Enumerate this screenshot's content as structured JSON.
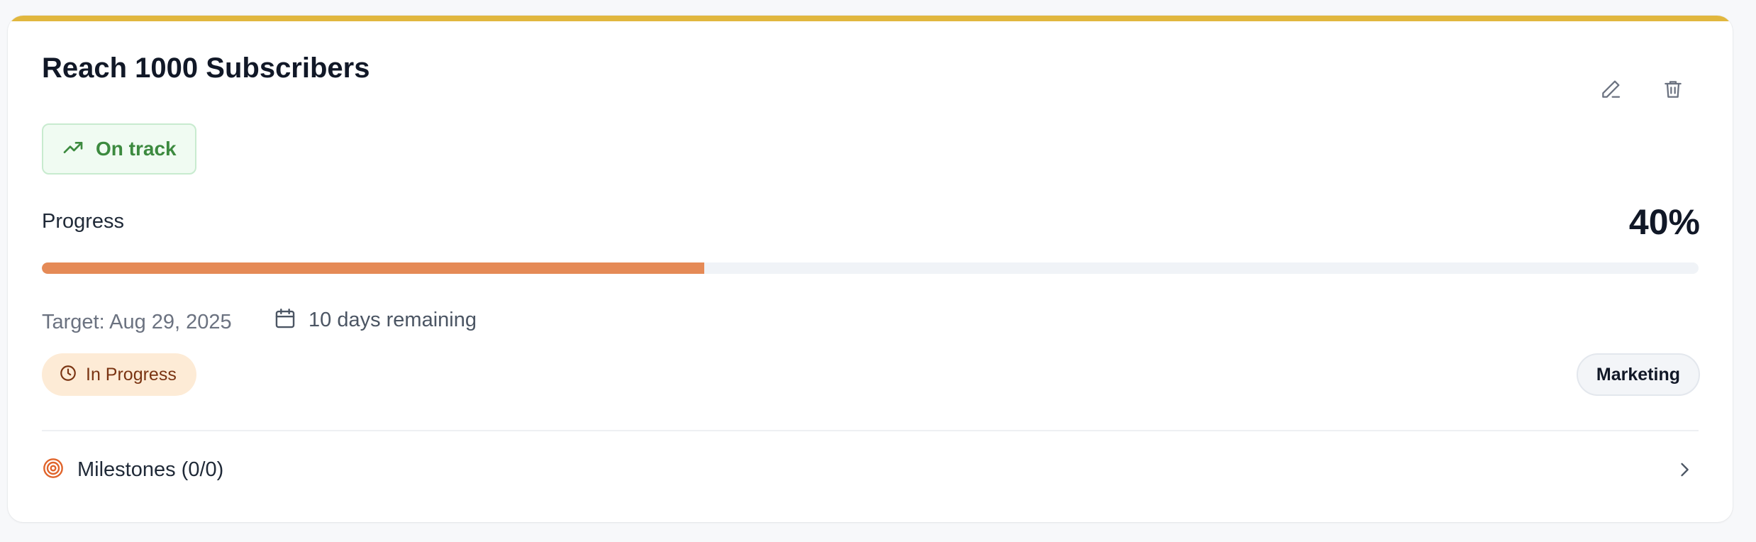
{
  "goal": {
    "title": "Reach 1000 Subscribers",
    "accent_color": "#e1b73e"
  },
  "actions": {
    "edit_icon": "pencil-icon",
    "delete_icon": "trash-icon"
  },
  "health": {
    "label": "On track",
    "icon": "trending-up-icon",
    "color": "#3c8a3f"
  },
  "progress": {
    "label": "Progress",
    "value_text": "40%",
    "fraction": 0.4,
    "fill_color": "#e58a56",
    "track_color": "#f0f3f7"
  },
  "schedule": {
    "target_text": "Target: Aug 29, 2025",
    "remaining_text": "10 days remaining",
    "remaining_icon": "calendar-icon"
  },
  "status": {
    "label": "In Progress",
    "icon": "clock-icon",
    "color": "#7a3412",
    "background": "#fdebd6"
  },
  "category": {
    "label": "Marketing"
  },
  "milestones": {
    "label": "Milestones (0/0)",
    "icon": "target-icon",
    "icon_color": "#e0642b"
  }
}
